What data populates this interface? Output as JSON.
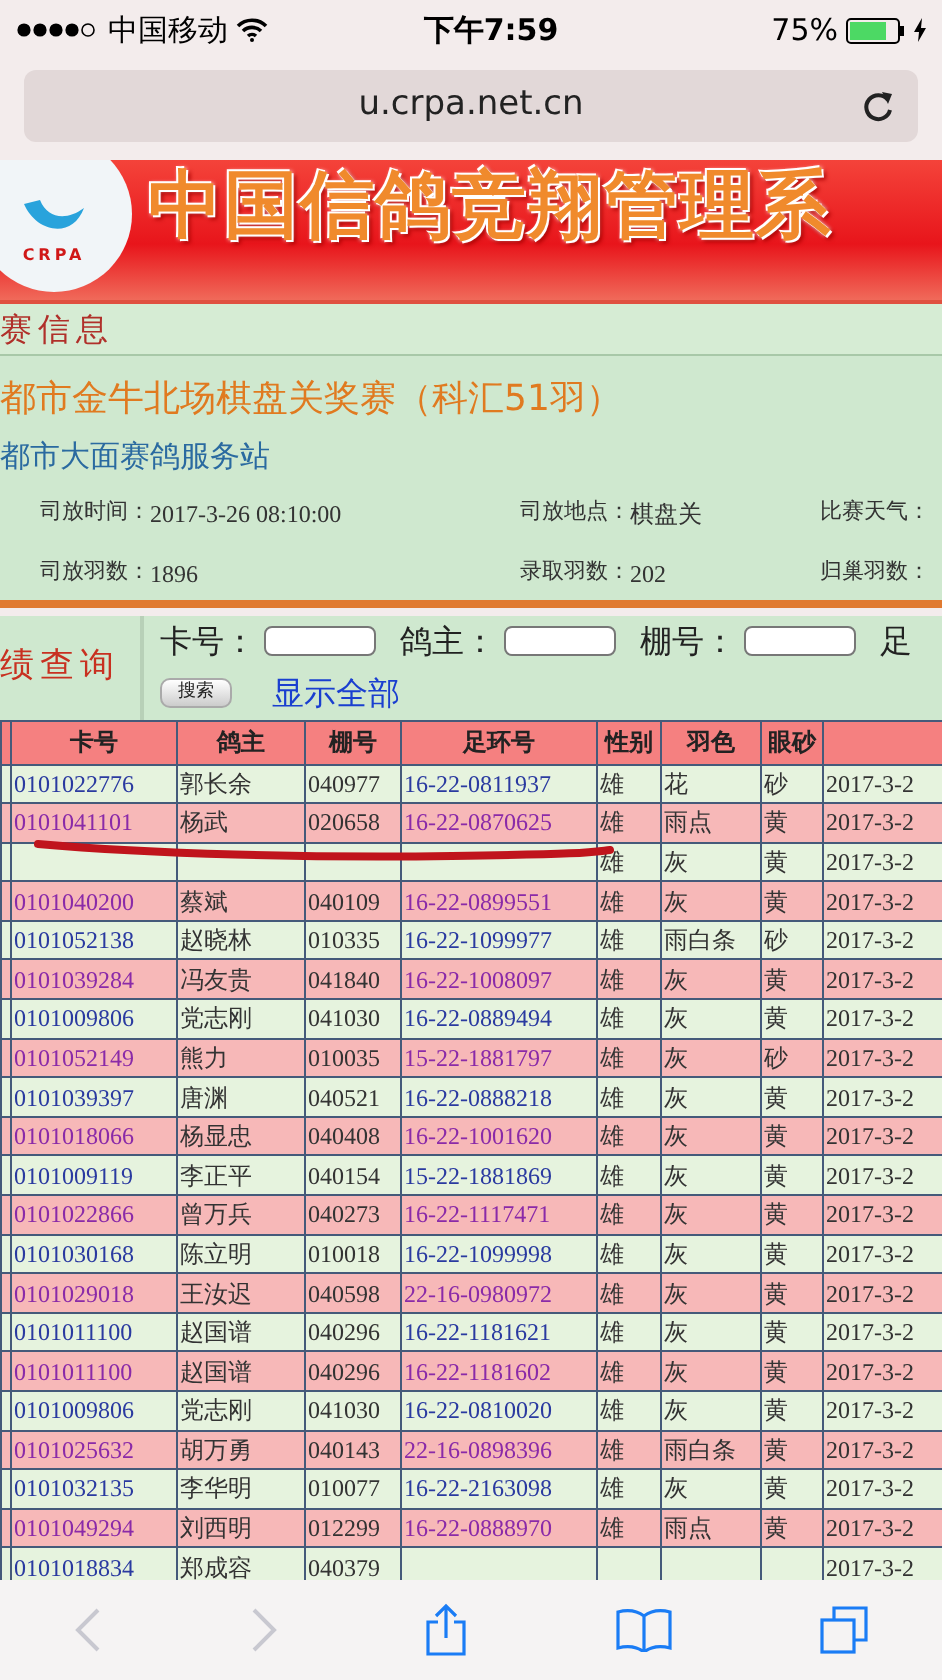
{
  "status_bar": {
    "carrier": "中国移动",
    "time": "下午7:59",
    "battery": "75%"
  },
  "browser": {
    "url": "u.crpa.net.cn"
  },
  "banner": {
    "logo_text": "CRPA",
    "title": "中国信鸽竞翔管理系"
  },
  "section_title": "赛信息",
  "race": {
    "title": "都市金牛北场棋盘关奖赛（科汇51羽）",
    "organizer": "都市大面赛鸽服务站",
    "fields": [
      {
        "label": "司放时间：",
        "value": "2017-3-26 08:10:00"
      },
      {
        "label": "司放地点：",
        "value": "棋盘关"
      },
      {
        "label": "比赛天气："
      },
      {
        "label": "司放羽数：",
        "value": "1896"
      },
      {
        "label": "录取羽数：",
        "value": "202"
      },
      {
        "label": "归巢羽数："
      }
    ]
  },
  "search": {
    "panel_title": "绩查询",
    "fields": [
      {
        "label": "卡号："
      },
      {
        "label": "鸽主："
      },
      {
        "label": "棚号："
      }
    ],
    "extra_label": "足",
    "button": "搜索",
    "link": "显示全部"
  },
  "table": {
    "columns": [
      "卡号",
      "鸽主",
      "棚号",
      "足环号",
      "性别",
      "羽色",
      "眼砂"
    ],
    "rows": [
      {
        "card": "0101022776",
        "owner": "郭长余",
        "pen": "040977",
        "ring": "16-22-0811937",
        "sex": "雄",
        "plumage": "花",
        "eye": "砂",
        "date": "2017-3-2",
        "struck": false
      },
      {
        "card": "0101041101",
        "owner": "杨武",
        "pen": "020658",
        "ring": "16-22-0870625",
        "sex": "雄",
        "plumage": "雨点",
        "eye": "黄",
        "date": "2017-3-2",
        "struck": false
      },
      {
        "sex": "雄",
        "plumage": "灰",
        "eye": "黄",
        "date": "2017-3-2",
        "struck": true
      },
      {
        "card": "0101040200",
        "owner": "蔡斌",
        "pen": "040109",
        "ring": "16-22-0899551",
        "sex": "雄",
        "plumage": "灰",
        "eye": "黄",
        "date": "2017-3-2",
        "struck": false
      },
      {
        "card": "0101052138",
        "owner": "赵晓林",
        "pen": "010335",
        "ring": "16-22-1099977",
        "sex": "雄",
        "plumage": "雨白条",
        "eye": "砂",
        "date": "2017-3-2",
        "struck": false
      },
      {
        "card": "0101039284",
        "owner": "冯友贵",
        "pen": "041840",
        "ring": "16-22-1008097",
        "sex": "雄",
        "plumage": "灰",
        "eye": "黄",
        "date": "2017-3-2",
        "struck": false
      },
      {
        "card": "0101009806",
        "owner": "党志刚",
        "pen": "041030",
        "ring": "16-22-0889494",
        "sex": "雄",
        "plumage": "灰",
        "eye": "黄",
        "date": "2017-3-2",
        "struck": false
      },
      {
        "card": "0101052149",
        "owner": "熊力",
        "pen": "010035",
        "ring": "15-22-1881797",
        "sex": "雄",
        "plumage": "灰",
        "eye": "砂",
        "date": "2017-3-2",
        "struck": false
      },
      {
        "card": "0101039397",
        "owner": "唐渊",
        "pen": "040521",
        "ring": "16-22-0888218",
        "sex": "雄",
        "plumage": "灰",
        "eye": "黄",
        "date": "2017-3-2",
        "struck": false
      },
      {
        "card": "0101018066",
        "owner": "杨显忠",
        "pen": "040408",
        "ring": "16-22-1001620",
        "sex": "雄",
        "plumage": "灰",
        "eye": "黄",
        "date": "2017-3-2",
        "struck": false
      },
      {
        "card": "0101009119",
        "owner": "李正平",
        "pen": "040154",
        "ring": "15-22-1881869",
        "sex": "雄",
        "plumage": "灰",
        "eye": "黄",
        "date": "2017-3-2",
        "struck": false
      },
      {
        "card": "0101022866",
        "owner": "曾万兵",
        "pen": "040273",
        "ring": "16-22-1117471",
        "sex": "雄",
        "plumage": "灰",
        "eye": "黄",
        "date": "2017-3-2",
        "struck": false
      },
      {
        "card": "0101030168",
        "owner": "陈立明",
        "pen": "010018",
        "ring": "16-22-1099998",
        "sex": "雄",
        "plumage": "灰",
        "eye": "黄",
        "date": "2017-3-2",
        "struck": false
      },
      {
        "card": "0101029018",
        "owner": "王汝迟",
        "pen": "040598",
        "ring": "22-16-0980972",
        "sex": "雄",
        "plumage": "灰",
        "eye": "黄",
        "date": "2017-3-2",
        "struck": false
      },
      {
        "card": "0101011100",
        "owner": "赵国谱",
        "pen": "040296",
        "ring": "16-22-1181621",
        "sex": "雄",
        "plumage": "灰",
        "eye": "黄",
        "date": "2017-3-2",
        "struck": false
      },
      {
        "card": "0101011100",
        "owner": "赵国谱",
        "pen": "040296",
        "ring": "16-22-1181602",
        "sex": "雄",
        "plumage": "灰",
        "eye": "黄",
        "date": "2017-3-2",
        "struck": false
      },
      {
        "card": "0101009806",
        "owner": "党志刚",
        "pen": "041030",
        "ring": "16-22-0810020",
        "sex": "雄",
        "plumage": "灰",
        "eye": "黄",
        "date": "2017-3-2",
        "struck": false
      },
      {
        "card": "0101025632",
        "owner": "胡万勇",
        "pen": "040143",
        "ring": "22-16-0898396",
        "sex": "雄",
        "plumage": "雨白条",
        "eye": "黄",
        "date": "2017-3-2",
        "struck": false
      },
      {
        "card": "0101032135",
        "owner": "李华明",
        "pen": "010077",
        "ring": "16-22-2163098",
        "sex": "雄",
        "plumage": "灰",
        "eye": "黄",
        "date": "2017-3-2",
        "struck": false
      },
      {
        "card": "0101049294",
        "owner": "刘西明",
        "pen": "012299",
        "ring": "16-22-0888970",
        "sex": "雄",
        "plumage": "雨点",
        "eye": "黄",
        "date": "2017-3-2",
        "struck": false
      },
      {
        "card": "0101018834",
        "owner": "郑成容",
        "pen": "040379",
        "date": "2017-3-2",
        "struck": false
      }
    ]
  }
}
